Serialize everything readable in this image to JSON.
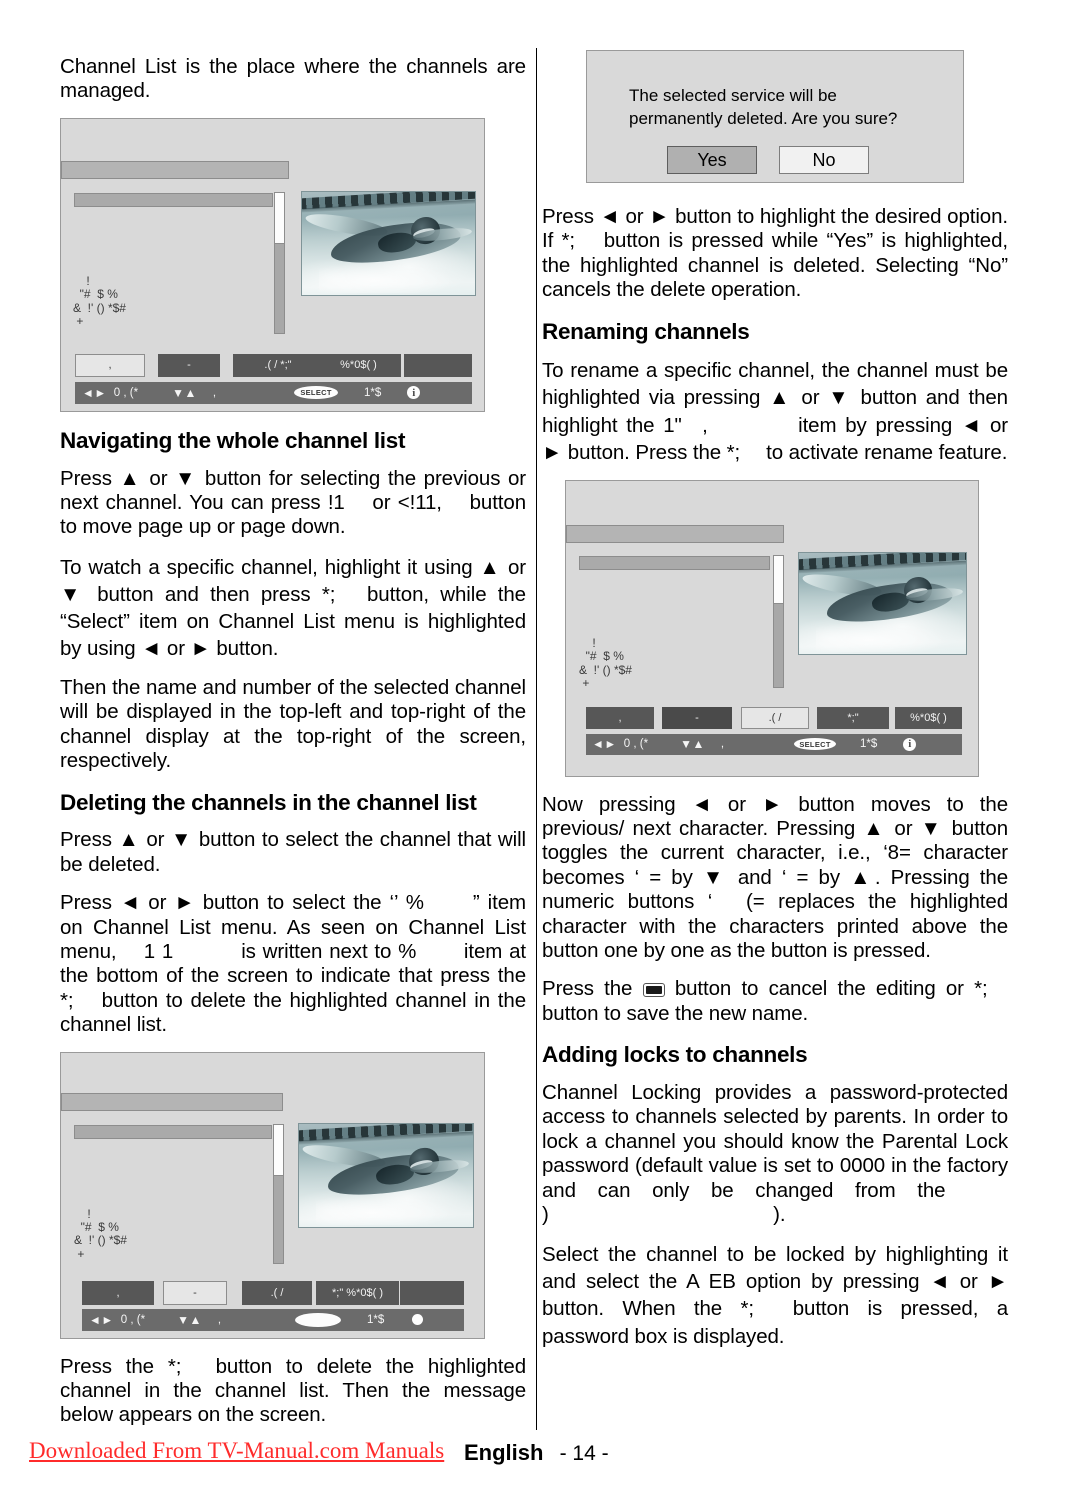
{
  "page": {
    "language_label": "English",
    "page_number": "- 14 -",
    "watermark": "Downloaded From TV-Manual.com Manuals"
  },
  "left_column": {
    "intro": "Channel List is the place where the channels are managed.",
    "heading_navigating": "Navigating the whole channel list",
    "nav_para_1": "Press ▲ or ▼ button for selecting the previous or next channel. You can press !1  or <!11,  button to move page up or page down.",
    "nav_para_2": "To watch a specific channel, highlight it using ▲ or ▼ button and then press *;  button, while the “Select” item on Channel List menu is highlighted by using ◄ or ► button.",
    "nav_para_3": "Then the name and number of the selected channel will be displayed in the top-left and top-right of the channel display at the top-right of the screen, respectively.",
    "heading_deleting": "Deleting the channels in the channel list",
    "del_para_1": "Press ▲ or ▼ button to select the channel that will be deleted.",
    "del_para_2": "Press ◄ or ► button to select the ‘’ %   ” item on Channel List menu. As seen on Channel List menu,  1 1    is written next to  %   item at the bottom of the screen to indicate that press the *;  button to delete the highlighted channel in the channel list.",
    "del_para_3": "Press the *;  button to delete the highlighted channel in the channel list. Then the message below appears on the screen."
  },
  "right_column": {
    "confirm_para": "Press ◄ or ► button to highlight the desired option. If *;  button is pressed while “Yes” is highlighted, the highlighted channel is deleted. Selecting “No” cancels the delete operation.",
    "heading_renaming": "Renaming channels",
    "rename_para_1": "To rename a specific channel, the channel must be highlighted via pressing ▲ or ▼ button and then highlight the 1\" ,     item by pressing ◄ or ► button. Press the *;  to activate rename feature.",
    "rename_para_2": "Now pressing ◄ or ► button moves to the previous/ next character. Pressing ▲ or ▼ button toggles the current character, i.e., ‘8= character becomes ‘ = by ▼ and ‘ = by ▲. Pressing the numeric buttons ‘  (= replaces the highlighted character with the characters printed above the button one by one as the button is pressed.",
    "rename_para_3_before": "Press the ",
    "rename_para_3_after": " button to cancel the editing or *;  button to save the new name.",
    "heading_locks": "Adding locks to channels",
    "lock_para_1": "Channel Locking provides a password-protected access to channels selected by parents. In order to lock a channel you should know the Parental Lock password (default value is set to 0000 in the factory and can only be changed from the    )           ).",
    "lock_para_2": "Select the channel to be locked by highlighting it and select the A  EB  option by pressing ◄ or ► button. When the *;  button is pressed, a password box is displayed."
  },
  "confirm_dialog": {
    "message": "The selected service will be permanently deleted. Are you sure?",
    "yes_label": "Yes",
    "no_label": "No"
  },
  "osd": {
    "garbled_menu": "    !\n  \"#  $ %\n&  !' () *$#\n +",
    "screens": [
      {
        "name": "channel-list-screen",
        "buttons": [
          ",",
          "-",
          ".(   /          *;\"",
          "%*0$(  )",
          ""
        ],
        "button_styles": [
          "light",
          "dark",
          "dark",
          "dark",
          "dark"
        ],
        "status": {
          "nav_lr_glyph": "◄►",
          "nav_lr_label": "0 , (*",
          "nav_ud_glyph": "▼▲",
          "nav_ud_label": ",",
          "select_label": "SELECT",
          "ok_label": "1*$",
          "info_label": "i"
        }
      },
      {
        "name": "channel-list-delete-screen",
        "buttons": [
          ",",
          "-",
          ".(    /",
          "*;\"          %*0$(  )",
          ""
        ],
        "button_styles": [
          "dark",
          "light",
          "dark",
          "dark",
          "dark"
        ],
        "status": {
          "nav_lr_glyph": "◄►",
          "nav_lr_label": "0 , (*",
          "nav_ud_glyph": "▼▲",
          "nav_ud_label": ",",
          "select_label": "",
          "ok_label": "1*$",
          "info_label": ""
        }
      },
      {
        "name": "channel-list-rename-screen",
        "buttons": [
          ",",
          "-",
          ".(   /",
          "*;\"",
          "%*0$(  )"
        ],
        "button_styles": [
          "dark",
          "dark2",
          "light",
          "dark",
          "dark"
        ],
        "status": {
          "nav_lr_glyph": "◄►",
          "nav_lr_label": "0 , (*",
          "nav_ud_glyph": "▼▲",
          "nav_ud_label": ",",
          "select_label": "SELECT",
          "ok_label": "1*$",
          "info_label": "i"
        }
      }
    ]
  },
  "colors": {
    "osd_bg": "#d9d9d9",
    "osd_title": "#b4b4b4",
    "osd_row": "#aaaaaa",
    "osd_button_dark": "#575757",
    "osd_statusbar": "#6b6b6b",
    "watermark_red": "#ff2b2b"
  }
}
